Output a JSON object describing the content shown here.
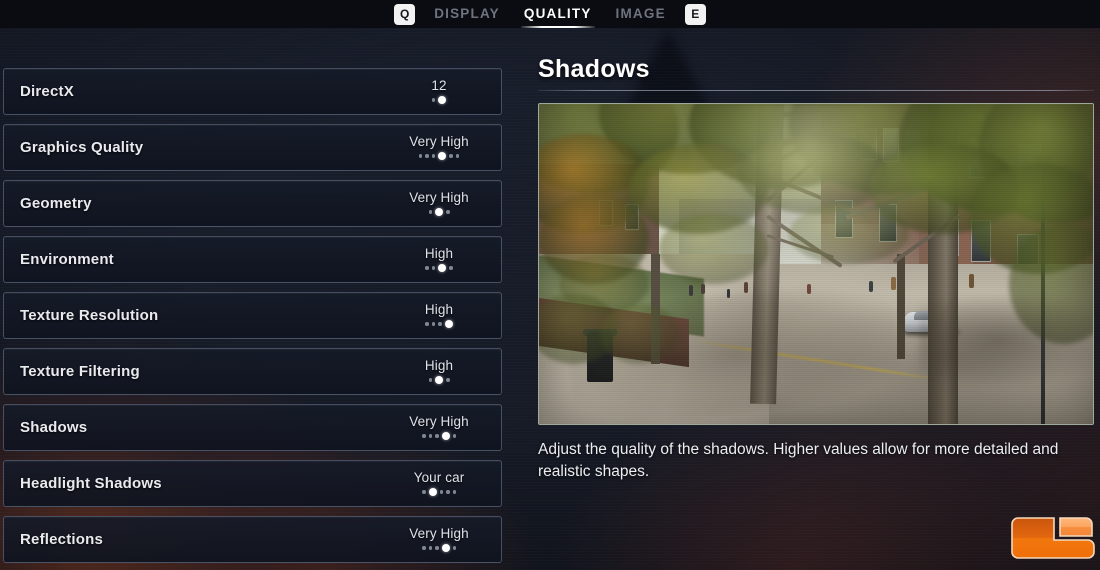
{
  "topbar": {
    "prev_key": "Q",
    "next_key": "E",
    "tabs": [
      {
        "label": "DISPLAY",
        "active": false
      },
      {
        "label": "QUALITY",
        "active": true
      },
      {
        "label": "IMAGE",
        "active": false
      }
    ]
  },
  "settings": [
    {
      "label": "DirectX",
      "value": "12",
      "dots": 2,
      "active": 2
    },
    {
      "label": "Graphics Quality",
      "value": "Very High",
      "dots": 6,
      "active": 4
    },
    {
      "label": "Geometry",
      "value": "Very High",
      "dots": 3,
      "active": 2
    },
    {
      "label": "Environment",
      "value": "High",
      "dots": 4,
      "active": 3
    },
    {
      "label": "Texture Resolution",
      "value": "High",
      "dots": 4,
      "active": 4
    },
    {
      "label": "Texture Filtering",
      "value": "High",
      "dots": 3,
      "active": 2
    },
    {
      "label": "Shadows",
      "value": "Very High",
      "dots": 5,
      "active": 4
    },
    {
      "label": "Headlight Shadows",
      "value": "Your car",
      "dots": 5,
      "active": 2
    },
    {
      "label": "Reflections",
      "value": "Very High",
      "dots": 5,
      "active": 4
    }
  ],
  "detail": {
    "title": "Shadows",
    "description": "Adjust the quality of the shadows. Higher values allow for more detailed and realistic shapes.",
    "preview_alt": "In-game preview: sunlit London street with autumn trees, Victorian brick buildings and a white sports car"
  },
  "watermark": {
    "name": "legit-reviews-logo",
    "color": "#f07d12"
  },
  "colors": {
    "accent": "#ffffff",
    "tab_inactive": "#6e737e",
    "row_border": "#96a5c3",
    "background": "#161b27",
    "topbar": "#0a0c12"
  }
}
